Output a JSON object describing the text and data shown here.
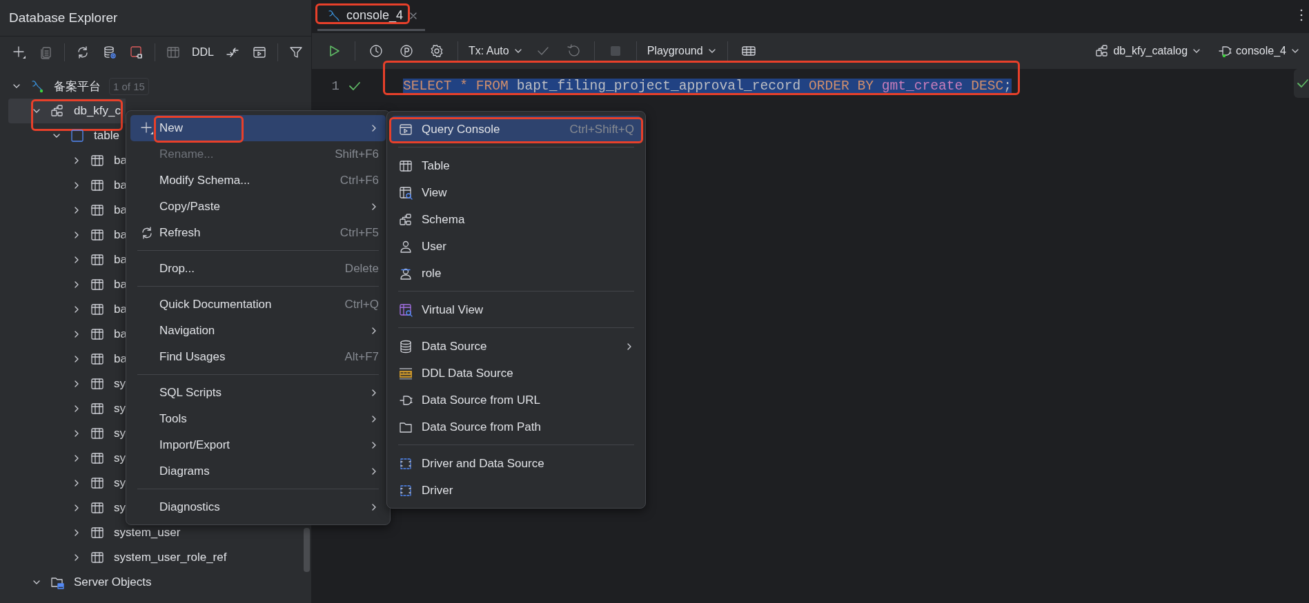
{
  "explorer": {
    "title": "Database Explorer",
    "toolbar": [
      {
        "kind": "icon",
        "disabled": false
      },
      {
        "kind": "icon",
        "disabled": true
      },
      {
        "kind": "separator"
      },
      {
        "kind": "icon",
        "disabled": false
      },
      {
        "kind": "icon",
        "disabled": false
      },
      {
        "kind": "icon",
        "disabled": false
      },
      {
        "kind": "separator"
      },
      {
        "kind": "icon",
        "disabled": true
      },
      {
        "kind": "text",
        "label": "DDL",
        "disabled": false
      },
      {
        "kind": "icon",
        "disabled": false
      },
      {
        "kind": "icon",
        "disabled": false
      },
      {
        "kind": "separator"
      },
      {
        "kind": "icon",
        "disabled": false
      }
    ],
    "tree": [
      {
        "kind": "datasource",
        "label": "备案平台",
        "badge": "1 of 15",
        "expanded": true,
        "selected": false,
        "highlighted": false,
        "children": [
          {
            "kind": "schema",
            "label": "db_kfy_c",
            "expanded": true,
            "selected": true,
            "highlighted": true,
            "children": [
              {
                "kind": "folder",
                "label": "table",
                "expanded": true,
                "selected": false,
                "highlighted": false,
                "children": [
                  {
                    "kind": "table",
                    "label": "ba",
                    "expanded": false,
                    "selected": false,
                    "highlighted": false
                  },
                  {
                    "kind": "table",
                    "label": "ba",
                    "expanded": false,
                    "selected": false,
                    "highlighted": false
                  },
                  {
                    "kind": "table",
                    "label": "ba",
                    "expanded": false,
                    "selected": false,
                    "highlighted": false
                  },
                  {
                    "kind": "table",
                    "label": "ba",
                    "expanded": false,
                    "selected": false,
                    "highlighted": false
                  },
                  {
                    "kind": "table",
                    "label": "ba",
                    "expanded": false,
                    "selected": false,
                    "highlighted": false
                  },
                  {
                    "kind": "table",
                    "label": "ba",
                    "expanded": false,
                    "selected": false,
                    "highlighted": false
                  },
                  {
                    "kind": "table",
                    "label": "ba",
                    "expanded": false,
                    "selected": false,
                    "highlighted": false
                  },
                  {
                    "kind": "table",
                    "label": "ba",
                    "expanded": false,
                    "selected": false,
                    "highlighted": false
                  },
                  {
                    "kind": "table",
                    "label": "ba",
                    "expanded": false,
                    "selected": false,
                    "highlighted": false
                  },
                  {
                    "kind": "table",
                    "label": "sy",
                    "expanded": false,
                    "selected": false,
                    "highlighted": false
                  },
                  {
                    "kind": "table",
                    "label": "sy",
                    "expanded": false,
                    "selected": false,
                    "highlighted": false
                  },
                  {
                    "kind": "table",
                    "label": "sy",
                    "expanded": false,
                    "selected": false,
                    "highlighted": false
                  },
                  {
                    "kind": "table",
                    "label": "sy",
                    "expanded": false,
                    "selected": false,
                    "highlighted": false
                  },
                  {
                    "kind": "table",
                    "label": "sy",
                    "expanded": false,
                    "selected": false,
                    "highlighted": false
                  },
                  {
                    "kind": "table",
                    "label": "sy",
                    "expanded": false,
                    "selected": false,
                    "highlighted": false
                  },
                  {
                    "kind": "table",
                    "label": "system_user",
                    "expanded": false,
                    "selected": false,
                    "highlighted": false
                  },
                  {
                    "kind": "table",
                    "label": "system_user_role_ref",
                    "expanded": false,
                    "selected": false,
                    "highlighted": false
                  }
                ]
              }
            ]
          },
          {
            "kind": "server",
            "label": "Server Objects",
            "expanded": true,
            "selected": false,
            "highlighted": false
          }
        ]
      }
    ]
  },
  "editor": {
    "tab": {
      "label": "console_4",
      "selected": true,
      "highlighted": true
    },
    "toolbar": [
      {
        "kind": "icon",
        "disabled": false
      },
      {
        "kind": "separator"
      },
      {
        "kind": "icon",
        "disabled": false
      },
      {
        "kind": "icon",
        "disabled": false
      },
      {
        "kind": "icon",
        "disabled": false
      },
      {
        "kind": "separator"
      },
      {
        "kind": "dropdown",
        "label": "Tx: Auto",
        "disabled": false
      },
      {
        "kind": "icon",
        "disabled": true
      },
      {
        "kind": "icon",
        "disabled": true
      },
      {
        "kind": "separator"
      },
      {
        "kind": "icon",
        "disabled": true
      },
      {
        "kind": "separator"
      },
      {
        "kind": "dropdown",
        "label": "Playground",
        "disabled": false
      },
      {
        "kind": "separator"
      },
      {
        "kind": "icon",
        "disabled": false
      }
    ],
    "context": [
      {
        "label": "db_kfy_catalog"
      },
      {
        "label": "console_4"
      }
    ],
    "lines": [
      {
        "number": "1",
        "valid": true,
        "selected": true,
        "highlighted": true,
        "tokens": [
          {
            "text": "SELECT",
            "kind": "keyword"
          },
          {
            "text": " * ",
            "kind": "keyword"
          },
          {
            "text": "FROM",
            "kind": "keyword"
          },
          {
            "text": " bapt_filing_project_approval_record ",
            "kind": "plain"
          },
          {
            "text": "ORDER BY",
            "kind": "keyword"
          },
          {
            "text": " gmt_create ",
            "kind": "column"
          },
          {
            "text": "DESC",
            "kind": "keyword"
          },
          {
            "text": ";",
            "kind": "plain"
          }
        ]
      }
    ]
  },
  "context_menu": {
    "items": [
      {
        "kind": "item",
        "label": "New",
        "submenu": true,
        "disabled": false,
        "selected": true,
        "highlighted": true
      },
      {
        "kind": "item",
        "label": "Rename...",
        "shortcut": "Shift+F6",
        "submenu": false,
        "disabled": true,
        "selected": false,
        "highlighted": false
      },
      {
        "kind": "item",
        "label": "Modify Schema...",
        "shortcut": "Ctrl+F6",
        "submenu": false,
        "disabled": false,
        "selected": false,
        "highlighted": false
      },
      {
        "kind": "item",
        "label": "Copy/Paste",
        "submenu": true,
        "disabled": false,
        "selected": false,
        "highlighted": false
      },
      {
        "kind": "item",
        "label": "Refresh",
        "shortcut": "Ctrl+F5",
        "submenu": false,
        "disabled": false,
        "selected": false,
        "highlighted": false
      },
      {
        "kind": "separator"
      },
      {
        "kind": "item",
        "label": "Drop...",
        "shortcut": "Delete",
        "submenu": false,
        "disabled": false,
        "selected": false,
        "highlighted": false
      },
      {
        "kind": "separator"
      },
      {
        "kind": "item",
        "label": "Quick Documentation",
        "shortcut": "Ctrl+Q",
        "submenu": false,
        "disabled": false,
        "selected": false,
        "highlighted": false
      },
      {
        "kind": "item",
        "label": "Navigation",
        "submenu": true,
        "disabled": false,
        "selected": false,
        "highlighted": false
      },
      {
        "kind": "item",
        "label": "Find Usages",
        "shortcut": "Alt+F7",
        "submenu": false,
        "disabled": false,
        "selected": false,
        "highlighted": false
      },
      {
        "kind": "separator"
      },
      {
        "kind": "item",
        "label": "SQL Scripts",
        "submenu": true,
        "disabled": false,
        "selected": false,
        "highlighted": false
      },
      {
        "kind": "item",
        "label": "Tools",
        "submenu": true,
        "disabled": false,
        "selected": false,
        "highlighted": false
      },
      {
        "kind": "item",
        "label": "Import/Export",
        "submenu": true,
        "disabled": false,
        "selected": false,
        "highlighted": false
      },
      {
        "kind": "item",
        "label": "Diagrams",
        "submenu": true,
        "disabled": false,
        "selected": false,
        "highlighted": false
      },
      {
        "kind": "separator"
      },
      {
        "kind": "item",
        "label": "Diagnostics",
        "submenu": true,
        "disabled": false,
        "selected": false,
        "highlighted": false
      }
    ]
  },
  "new_submenu": {
    "items": [
      {
        "kind": "item",
        "label": "Query Console",
        "shortcut": "Ctrl+Shift+Q",
        "submenu": false,
        "disabled": false,
        "selected": true,
        "highlighted": true
      },
      {
        "kind": "separator"
      },
      {
        "kind": "item",
        "label": "Table",
        "submenu": false,
        "disabled": false,
        "selected": false,
        "highlighted": false
      },
      {
        "kind": "item",
        "label": "View",
        "submenu": false,
        "disabled": false,
        "selected": false,
        "highlighted": false
      },
      {
        "kind": "item",
        "label": "Schema",
        "submenu": false,
        "disabled": false,
        "selected": false,
        "highlighted": false
      },
      {
        "kind": "item",
        "label": "User",
        "submenu": false,
        "disabled": false,
        "selected": false,
        "highlighted": false
      },
      {
        "kind": "item",
        "label": "role",
        "submenu": false,
        "disabled": false,
        "selected": false,
        "highlighted": false
      },
      {
        "kind": "separator"
      },
      {
        "kind": "item",
        "label": "Virtual View",
        "submenu": false,
        "disabled": false,
        "selected": false,
        "highlighted": false
      },
      {
        "kind": "separator"
      },
      {
        "kind": "item",
        "label": "Data Source",
        "submenu": true,
        "disabled": false,
        "selected": false,
        "highlighted": false
      },
      {
        "kind": "item",
        "label": "DDL Data Source",
        "submenu": false,
        "disabled": false,
        "selected": false,
        "highlighted": false
      },
      {
        "kind": "item",
        "label": "Data Source from URL",
        "submenu": false,
        "disabled": false,
        "selected": false,
        "highlighted": false
      },
      {
        "kind": "item",
        "label": "Data Source from Path",
        "submenu": false,
        "disabled": false,
        "selected": false,
        "highlighted": false
      },
      {
        "kind": "separator"
      },
      {
        "kind": "item",
        "label": "Driver and Data Source",
        "submenu": false,
        "disabled": false,
        "selected": false,
        "highlighted": false
      },
      {
        "kind": "item",
        "label": "Driver",
        "submenu": false,
        "disabled": false,
        "selected": false,
        "highlighted": false
      }
    ]
  }
}
